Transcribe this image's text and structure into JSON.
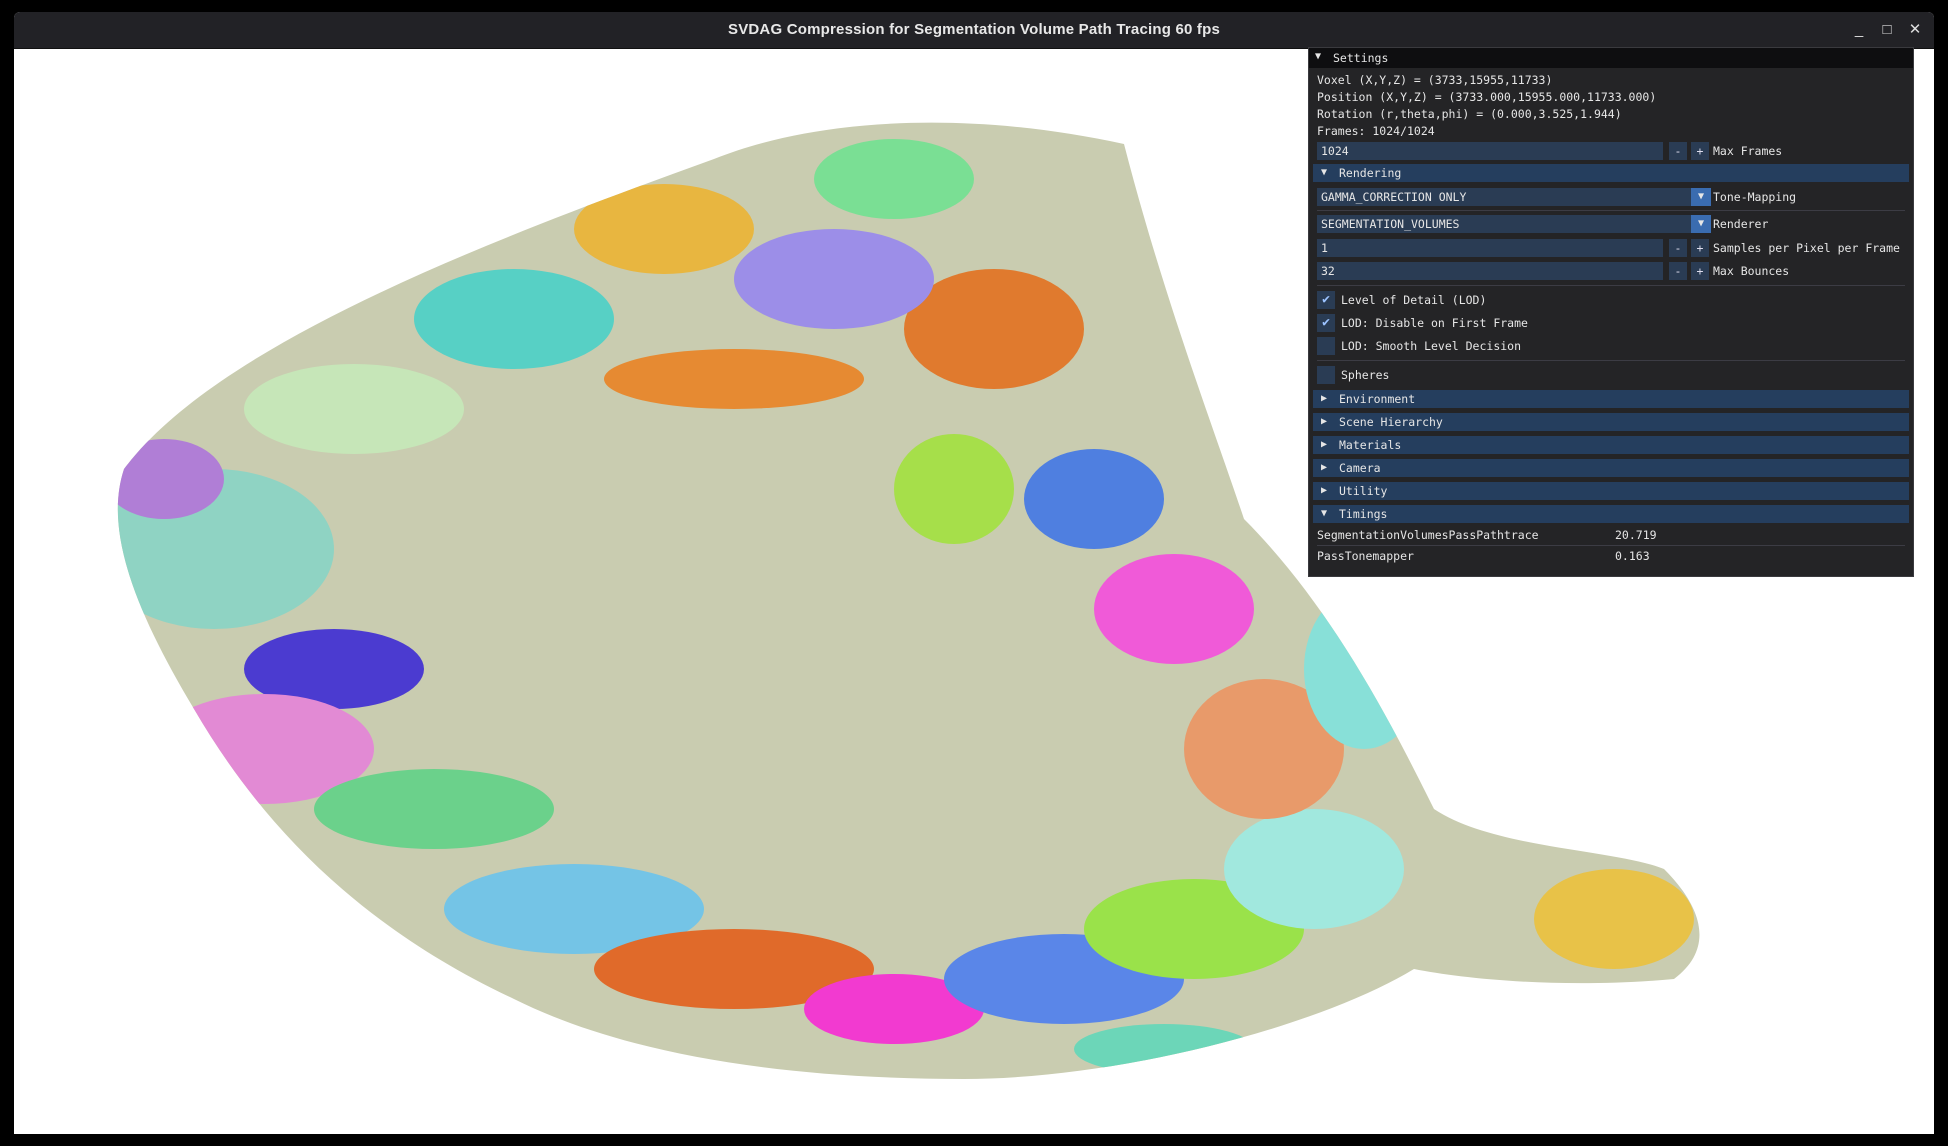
{
  "window": {
    "title": "SVDAG Compression for Segmentation Volume Path Tracing  60 fps",
    "minimize_glyph": "_",
    "maximize_glyph": "□",
    "close_glyph": "✕"
  },
  "settings": {
    "header": "Settings",
    "voxel": "Voxel (X,Y,Z) = (3733,15955,11733)",
    "position": "Position (X,Y,Z) = (3733.000,15955.000,11733.000)",
    "rotation": "Rotation (r,theta,phi) = (0.000,3.525,1.944)",
    "frames": "Frames: 1024/1024",
    "max_frames": {
      "value": "1024",
      "label": "Max Frames"
    },
    "rendering": {
      "header": "Rendering",
      "tone_mapping": {
        "value": "GAMMA_CORRECTION ONLY",
        "label": "Tone-Mapping"
      },
      "renderer": {
        "value": "SEGMENTATION_VOLUMES",
        "label": "Renderer"
      },
      "spp": {
        "value": "1",
        "label": "Samples per Pixel per Frame"
      },
      "max_bounces": {
        "value": "32",
        "label": "Max Bounces"
      },
      "lod": {
        "label": "Level of Detail (LOD)",
        "checked": true
      },
      "lod_first_frame": {
        "label": "LOD: Disable on First Frame",
        "checked": true
      },
      "lod_smooth": {
        "label": "LOD: Smooth Level Decision",
        "checked": false
      }
    },
    "spheres": {
      "label": "Spheres",
      "checked": false
    },
    "sections": [
      "Environment",
      "Scene Hierarchy",
      "Materials",
      "Camera",
      "Utility"
    ],
    "timings": {
      "header": "Timings",
      "rows": [
        {
          "name": "SegmentationVolumesPassPathtrace",
          "value": "20.719"
        },
        {
          "name": "PassTonemapper",
          "value": "0.163"
        }
      ]
    },
    "minus": "-",
    "plus": "+"
  },
  "colors": {
    "accent": "#253e5e",
    "frame_bg": "#2a3c54",
    "check": "#9cc3ff",
    "panel_bg": "#161618"
  }
}
